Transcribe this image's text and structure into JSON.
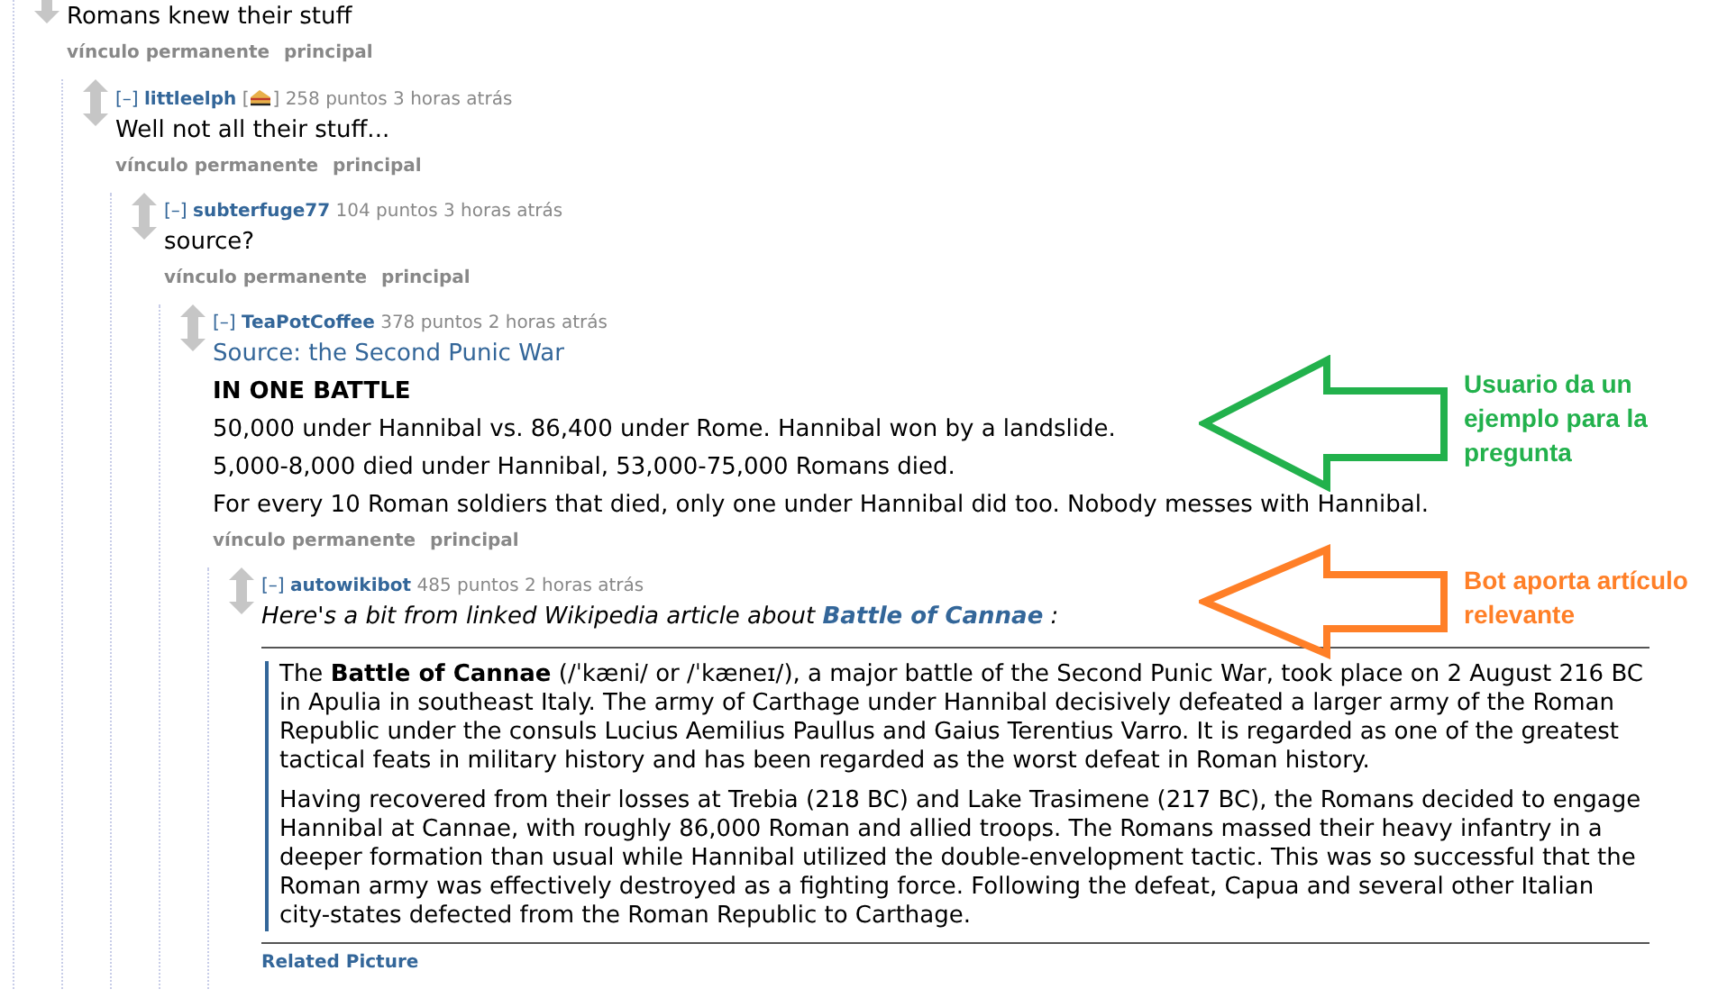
{
  "comment": {
    "body": [
      {
        "kind": "text",
        "text": "Romans knew their stuff"
      }
    ],
    "links": [
      {
        "label": "vínculo permanente",
        "kind": "action"
      },
      {
        "label": "principal",
        "kind": "action"
      }
    ],
    "children": [
      {
        "toggle": "[–]",
        "author": "littleelph",
        "flair": {
          "open": "[",
          "close": "]"
        },
        "score": "258 puntos",
        "time": "3 horas atrás",
        "body": [
          {
            "kind": "text",
            "text": "Well not all their stuff..."
          }
        ],
        "links": [
          {
            "label": "vínculo permanente",
            "kind": "action"
          },
          {
            "label": "principal",
            "kind": "action"
          }
        ],
        "children": [
          {
            "toggle": "[–]",
            "author": "subterfuge77",
            "score": "104 puntos",
            "time": "3 horas atrás",
            "body": [
              {
                "kind": "text",
                "text": "source?"
              }
            ],
            "links": [
              {
                "label": "vínculo permanente",
                "kind": "action"
              },
              {
                "label": "principal",
                "kind": "action"
              }
            ],
            "children": [
              {
                "toggle": "[–]",
                "author": "TeaPotCoffee",
                "score": "378 puntos",
                "time": "2 horas atrás",
                "body": [
                  {
                    "kind": "link",
                    "text": "Source: the Second Punic War"
                  },
                  {
                    "kind": "heading",
                    "text": "IN ONE BATTLE"
                  },
                  {
                    "kind": "text",
                    "text": "50,000 under Hannibal vs. 86,400 under Rome. Hannibal won by a landslide."
                  },
                  {
                    "kind": "text",
                    "text": "5,000-8,000 died under Hannibal, 53,000-75,000 Romans died."
                  },
                  {
                    "kind": "text",
                    "text": "For every 10 Roman soldiers that died, only one under Hannibal did too. Nobody messes with Hannibal."
                  }
                ],
                "links": [
                  {
                    "label": "vínculo permanente",
                    "kind": "action"
                  },
                  {
                    "label": "principal",
                    "kind": "action"
                  }
                ],
                "children": [
                  {
                    "toggle": "[–]",
                    "author": "autowikibot",
                    "score": "485 puntos",
                    "time": "2 horas atrás",
                    "body": [
                      {
                        "kind": "intro",
                        "text": "Here's a bit from linked Wikipedia article about **Battle of Cannae** :"
                      },
                      {
                        "kind": "quote",
                        "paragraphs": [
                          "The **Battle of Cannae** (/ˈkæni/ or /ˈkæneɪ/), a major battle of the Second Punic War, took place on 2 August 216 BC in Apulia in southeast Italy. The army of Carthage under Hannibal decisively defeated a larger army of the Roman Republic under the consuls Lucius Aemilius Paullus and Gaius Terentius Varro. It is regarded as one of the greatest tactical feats in military history and has been regarded as the worst defeat in Roman history.",
                          "Having recovered from their losses at Trebia (218 BC) and Lake Trasimene (217 BC), the Romans decided to engage Hannibal at Cannae, with roughly 86,000 Roman and allied troops. The Romans massed their heavy infantry in a deeper formation than usual while Hannibal utilized the double-envelopment tactic. This was so successful that the Roman army was effectively destroyed as a fighting force. Following the defeat, Capua and several other Italian city-states defected from the Roman Republic to Carthage."
                        ]
                      }
                    ],
                    "links": [
                      {
                        "label": "Related Picture",
                        "kind": "related"
                      }
                    ]
                  }
                ]
              }
            ]
          }
        ]
      }
    ]
  },
  "annotations": [
    {
      "text": "Usuario da un ejemplo para la pregunta",
      "color": "#22b14c"
    },
    {
      "text": "Bot aporta artículo relevante",
      "color": "#ff7f27"
    }
  ]
}
